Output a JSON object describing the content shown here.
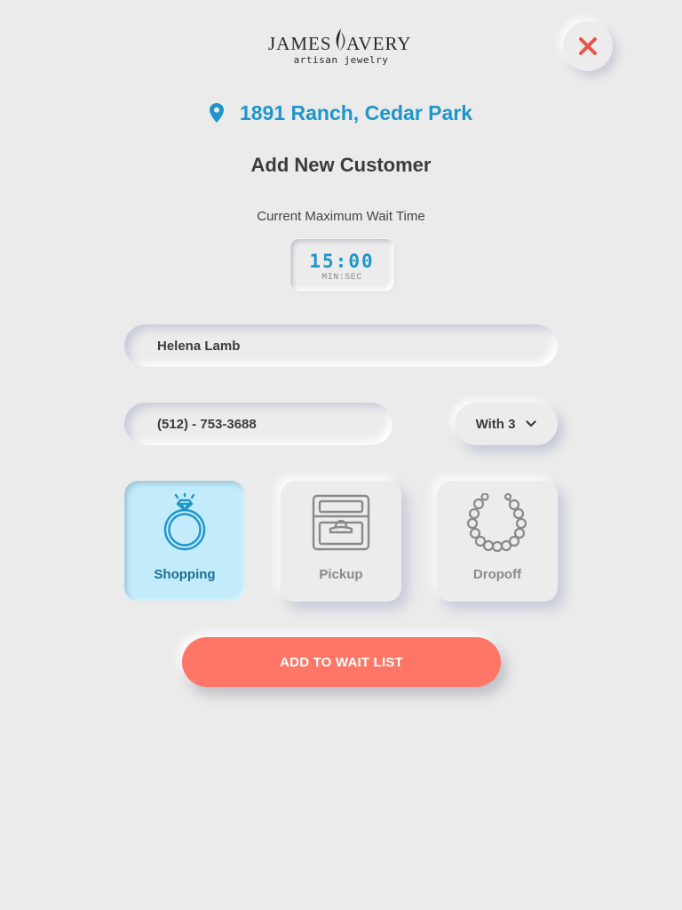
{
  "brand": {
    "name": "JAMES AVERY",
    "tagline": "artisan jewelry"
  },
  "header": {
    "close_icon": "close-icon"
  },
  "location": {
    "icon": "map-pin-icon",
    "label": "1891 Ranch, Cedar Park"
  },
  "title": "Add New Customer",
  "wait": {
    "label": "Current Maximum Wait Time",
    "value": "15:00",
    "unit": "MIN:SEC"
  },
  "form": {
    "name_value": "Helena Lamb",
    "phone_value": "(512) - 753-3688",
    "party_label": "With 3",
    "party_icon": "chevron-down-icon"
  },
  "options": [
    {
      "label": "Shopping",
      "icon": "ring-icon",
      "selected": true
    },
    {
      "label": "Pickup",
      "icon": "ring-box-icon",
      "selected": false
    },
    {
      "label": "Dropoff",
      "icon": "bracelet-icon",
      "selected": false
    }
  ],
  "cta_label": "ADD TO WAIT LIST",
  "colors": {
    "accent_blue": "#1f96c9",
    "cta_coral": "#ff7566",
    "close_red": "#e8554a",
    "selected_bg": "#c2ebfb",
    "background": "#ebebeb"
  }
}
